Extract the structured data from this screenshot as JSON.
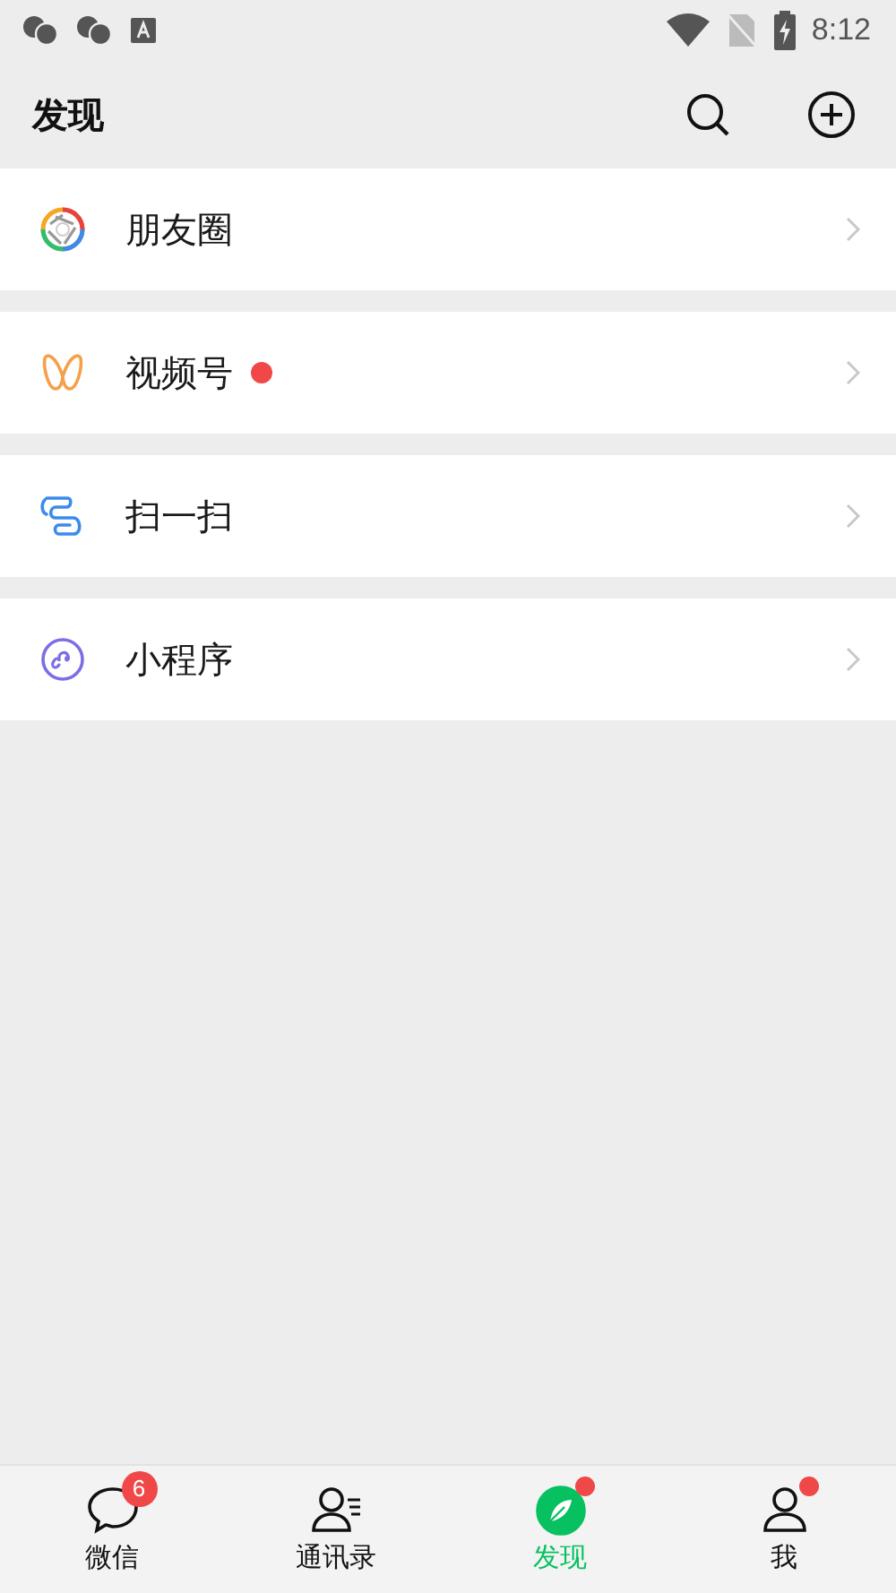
{
  "status_bar": {
    "time": "8:12"
  },
  "header": {
    "title": "发现"
  },
  "items": [
    {
      "label": "朋友圈",
      "kind": "moments",
      "dot": false
    },
    {
      "label": "视频号",
      "kind": "channels",
      "dot": true
    },
    {
      "label": "扫一扫",
      "kind": "scan",
      "dot": false
    },
    {
      "label": "小程序",
      "kind": "miniprogram",
      "dot": false
    }
  ],
  "tabs": [
    {
      "label": "微信",
      "kind": "chats",
      "selected": false,
      "badge": "6",
      "dot": false
    },
    {
      "label": "通讯录",
      "kind": "contacts",
      "selected": false,
      "dot": false
    },
    {
      "label": "发现",
      "kind": "discover",
      "selected": true,
      "dot": true
    },
    {
      "label": "我",
      "kind": "me",
      "selected": false,
      "dot": true
    }
  ]
}
